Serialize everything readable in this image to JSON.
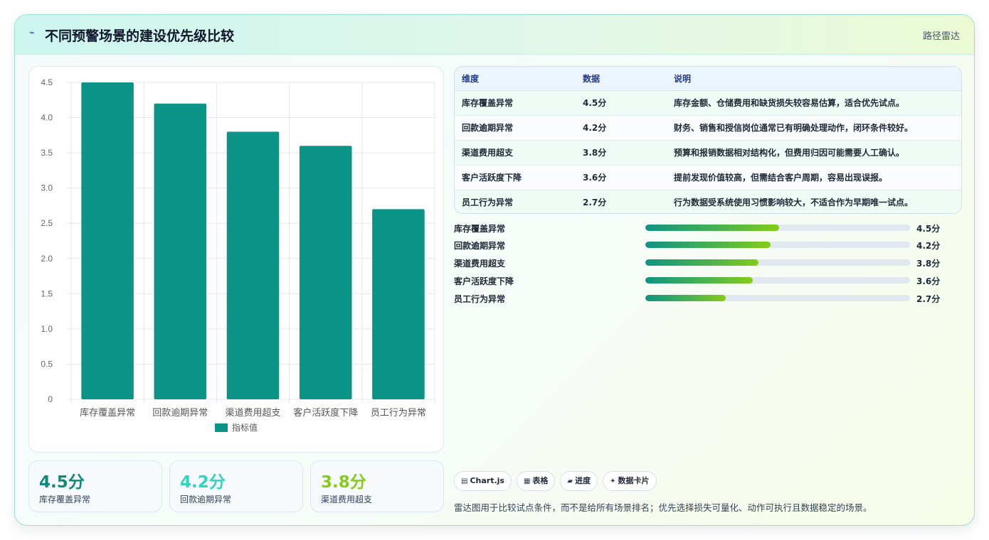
{
  "header": {
    "icon": "lightning-icon",
    "title": "不同预警场景的建设优先级比较",
    "badge": "路径雷达"
  },
  "chart_data": {
    "type": "bar",
    "categories": [
      "库存覆盖异常",
      "回款逾期异常",
      "渠道费用超支",
      "客户活跃度下降",
      "员工行为异常"
    ],
    "series": [
      {
        "name": "指标值",
        "values": [
          4.5,
          4.2,
          3.8,
          3.6,
          2.7
        ],
        "color": "#0d9488"
      }
    ],
    "y_ticks": [
      "0",
      "0.5",
      "1.0",
      "1.5",
      "2.0",
      "2.5",
      "3.0",
      "3.5",
      "4.0",
      "4.5"
    ],
    "ylim": [
      0,
      4.5
    ],
    "grid": true,
    "legend_position": "bottom"
  },
  "kpis": [
    {
      "value": "4.5分",
      "label": "库存覆盖异常",
      "color": "#0f8a78"
    },
    {
      "value": "4.2分",
      "label": "回款逾期异常",
      "color": "#2dd4bf"
    },
    {
      "value": "3.8分",
      "label": "渠道费用超支",
      "color": "#84cc16"
    }
  ],
  "table": {
    "headers": [
      "维度",
      "数据",
      "说明"
    ],
    "rows": [
      [
        "库存覆盖异常",
        "4.5分",
        "库存金额、仓储费用和缺货损失较容易估算，适合优先试点。"
      ],
      [
        "回款逾期异常",
        "4.2分",
        "财务、销售和授信岗位通常已有明确处理动作，闭环条件较好。"
      ],
      [
        "渠道费用超支",
        "3.8分",
        "预算和报销数据相对结构化，但费用归因可能需要人工确认。"
      ],
      [
        "客户活跃度下降",
        "3.6分",
        "提前发现价值较高，但需结合客户周期，容易出现误报。"
      ],
      [
        "员工行为异常",
        "2.7分",
        "行为数据受系统使用习惯影响较大，不适合作为早期唯一试点。"
      ]
    ]
  },
  "progress": [
    {
      "label": "库存覆盖异常",
      "value": "4.5分",
      "fraction": 0.506
    },
    {
      "label": "回款逾期异常",
      "value": "4.2分",
      "fraction": 0.472
    },
    {
      "label": "渠道费用超支",
      "value": "3.8分",
      "fraction": 0.427
    },
    {
      "label": "客户活跃度下降",
      "value": "3.6分",
      "fraction": 0.405
    },
    {
      "label": "员工行为异常",
      "value": "2.7分",
      "fraction": 0.303
    }
  ],
  "chips": [
    {
      "icon": "chart-icon",
      "glyph": "▤",
      "label": "Chart.js"
    },
    {
      "icon": "table-icon",
      "glyph": "▦",
      "label": "表格"
    },
    {
      "icon": "progress-icon",
      "glyph": "▰",
      "label": "进度"
    },
    {
      "icon": "sparkle-icon",
      "glyph": "✦",
      "label": "数据卡片"
    }
  ],
  "footer_note": "雷达图用于比较试点条件，而不是给所有场景排名；优先选择损失可量化、动作可执行且数据稳定的场景。"
}
